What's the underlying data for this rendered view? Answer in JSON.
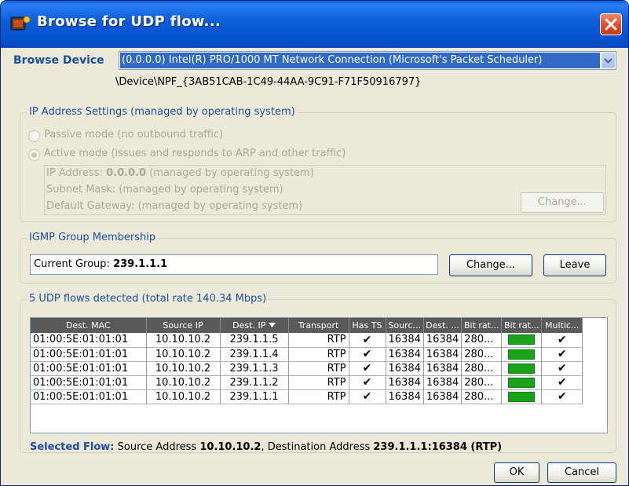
{
  "window": {
    "title": "Browse for UDP flow..."
  },
  "browse": {
    "label": "Browse Device",
    "selected_device": "(0.0.0.0) Intel(R) PRO/1000 MT Network Connection (Microsoft's Packet Scheduler)",
    "device_path": "\\Device\\NPF_{3AB51CAB-1C49-44AA-9C91-F71F50916797}"
  },
  "ip_settings": {
    "title": "IP Address Settings (managed by operating system)",
    "passive_label": "Passive mode (no outbound traffic)",
    "active_label": "Active mode (issues and responds to ARP and other traffic)",
    "ip_prefix": "IP Address: ",
    "ip_value": "0.0.0.0",
    "ip_suffix": " (managed by operating system)",
    "subnet": "Subnet Mask: (managed by operating system)",
    "gateway": "Default Gateway: (managed by operating system)",
    "change_label": "Change..."
  },
  "igmp": {
    "title": "IGMP Group Membership",
    "current_prefix": "Current Group: ",
    "current_value": "239.1.1.1",
    "change_label": "Change...",
    "leave_label": "Leave"
  },
  "flows": {
    "title": "5 UDP flows detected (total rate 140.34 Mbps)",
    "columns": [
      "Dest. MAC",
      "Source IP",
      "Dest. IP",
      "Transport",
      "Has TS",
      "Sourc...",
      "Dest. ...",
      "Bit rat...",
      "Bit rat...",
      "Multic..."
    ],
    "rows": [
      {
        "mac": "01:00:5E:01:01:01",
        "src": "10.10.10.2",
        "dst": "239.1.1.5",
        "transport": "RTP",
        "has_ts": "✔",
        "sport": "16384",
        "dport": "16384",
        "rate": "280...",
        "multicast": "✔"
      },
      {
        "mac": "01:00:5E:01:01:01",
        "src": "10.10.10.2",
        "dst": "239.1.1.4",
        "transport": "RTP",
        "has_ts": "✔",
        "sport": "16384",
        "dport": "16384",
        "rate": "280...",
        "multicast": "✔"
      },
      {
        "mac": "01:00:5E:01:01:01",
        "src": "10.10.10.2",
        "dst": "239.1.1.3",
        "transport": "RTP",
        "has_ts": "✔",
        "sport": "16384",
        "dport": "16384",
        "rate": "280...",
        "multicast": "✔"
      },
      {
        "mac": "01:00:5E:01:01:01",
        "src": "10.10.10.2",
        "dst": "239.1.1.2",
        "transport": "RTP",
        "has_ts": "✔",
        "sport": "16384",
        "dport": "16384",
        "rate": "280...",
        "multicast": "✔"
      },
      {
        "mac": "01:00:5E:01:01:01",
        "src": "10.10.10.2",
        "dst": "239.1.1.1",
        "transport": "RTP",
        "has_ts": "✔",
        "sport": "16384",
        "dport": "16384",
        "rate": "280...",
        "multicast": "✔"
      }
    ],
    "selected_label": "Selected Flow:",
    "selected_src_prefix": " Source Address ",
    "selected_src": "10.10.10.2",
    "selected_dst_prefix": ", Destination Address ",
    "selected_dst": "239.1.1.1:16384 (RTP)"
  },
  "footer": {
    "ok_label": "OK",
    "cancel_label": "Cancel"
  },
  "colors": {
    "accent": "#1a4fa0",
    "titlebar": "#0b5bd8",
    "bitrate_bar": "#19a219",
    "close": "#e0502a"
  }
}
